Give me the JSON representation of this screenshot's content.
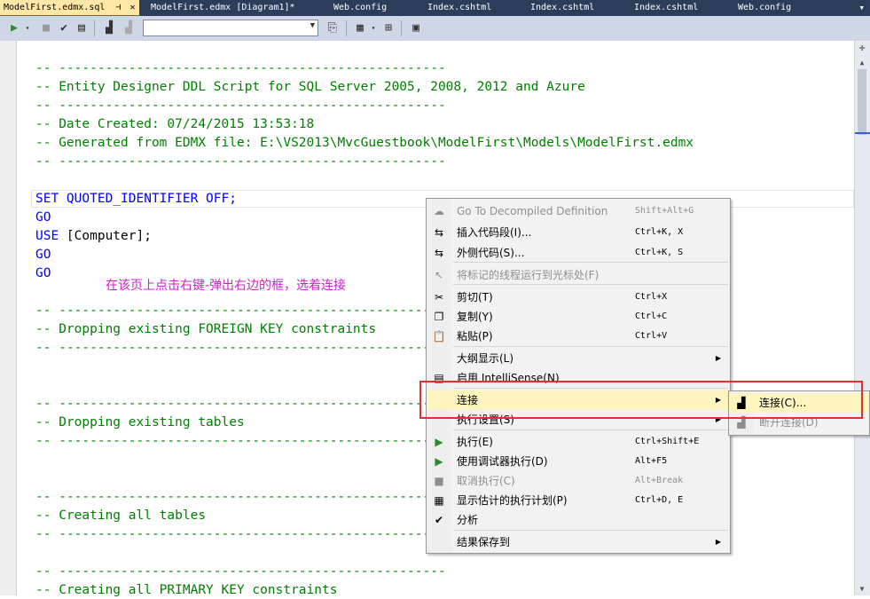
{
  "tabs": [
    {
      "label": "ModelFirst.edmx.sql",
      "active": true
    },
    {
      "label": "ModelFirst.edmx [Diagram1]*"
    },
    {
      "label": "Web.config"
    },
    {
      "label": "Index.cshtml"
    },
    {
      "label": "Index.cshtml"
    },
    {
      "label": "Index.cshtml"
    },
    {
      "label": "Web.config"
    }
  ],
  "tab_icons": {
    "pin": "pin-icon",
    "close": "close-icon",
    "overflow": "tab-overflow-icon"
  },
  "toolbar": {
    "database_select": {
      "value": ""
    }
  },
  "code_lines": [
    {
      "text": "-- --------------------------------------------------",
      "cls": "cmt"
    },
    {
      "text": "-- Entity Designer DDL Script for SQL Server 2005, 2008, 2012 and Azure",
      "cls": "cmt"
    },
    {
      "text": "-- --------------------------------------------------",
      "cls": "cmt"
    },
    {
      "text": "-- Date Created: 07/24/2015 13:53:18",
      "cls": "cmt"
    },
    {
      "text": "-- Generated from EDMX file: E:\\VS2013\\MvcGuestbook\\ModelFirst\\Models\\ModelFirst.edmx",
      "cls": "cmt"
    },
    {
      "text": "-- --------------------------------------------------",
      "cls": "cmt"
    },
    {
      "text": "",
      "cls": "txt"
    },
    {
      "text": "SET QUOTED_IDENTIFIER OFF;",
      "cls": "kw"
    },
    {
      "text": "GO",
      "cls": "kw"
    },
    {
      "text": "USE [Computer];",
      "cls": "mix"
    },
    {
      "text": "GO",
      "cls": "kw"
    },
    {
      "text": "GO",
      "cls": "kw"
    },
    {
      "text": "",
      "cls": "txt"
    },
    {
      "text": "-- --------------------------------------------------",
      "cls": "cmt"
    },
    {
      "text": "-- Dropping existing FOREIGN KEY constraints",
      "cls": "cmt"
    },
    {
      "text": "-- --------------------------------------------------",
      "cls": "cmt"
    },
    {
      "text": "",
      "cls": "txt"
    },
    {
      "text": "",
      "cls": "txt"
    },
    {
      "text": "-- --------------------------------------------------",
      "cls": "cmt"
    },
    {
      "text": "-- Dropping existing tables",
      "cls": "cmt"
    },
    {
      "text": "-- --------------------------------------------------",
      "cls": "cmt"
    },
    {
      "text": "",
      "cls": "txt"
    },
    {
      "text": "",
      "cls": "txt"
    },
    {
      "text": "-- --------------------------------------------------",
      "cls": "cmt"
    },
    {
      "text": "-- Creating all tables",
      "cls": "cmt"
    },
    {
      "text": "-- --------------------------------------------------",
      "cls": "cmt"
    },
    {
      "text": "",
      "cls": "txt"
    },
    {
      "text": "-- --------------------------------------------------",
      "cls": "cmt"
    },
    {
      "text": "-- Creating all PRIMARY KEY constraints",
      "cls": "cmt"
    }
  ],
  "use_line": {
    "keyword": "USE",
    "rest": " [Computer];"
  },
  "annotation": "在该页上点击右键-弹出右边的框，选着连接",
  "context_menu": {
    "items": [
      {
        "label": "Go To Decompiled Definition",
        "shortcut": "Shift+Alt+G",
        "icon": "decompile-icon",
        "glyph": "☁",
        "disabled": true
      },
      {
        "label": "插入代码段(I)...",
        "shortcut": "Ctrl+K, X",
        "icon": "snippet-icon",
        "glyph": "⇆"
      },
      {
        "label": "外侧代码(S)...",
        "shortcut": "Ctrl+K, S",
        "icon": "surround-icon",
        "glyph": "⇆"
      },
      {
        "label": "将标记的线程运行到光标处(F)",
        "shortcut": "",
        "icon": "run-to-cursor-icon",
        "glyph": "↖",
        "disabled": true
      },
      {
        "label": "剪切(T)",
        "shortcut": "Ctrl+X",
        "icon": "cut-icon",
        "glyph": "✂"
      },
      {
        "label": "复制(Y)",
        "shortcut": "Ctrl+C",
        "icon": "copy-icon",
        "glyph": "❐"
      },
      {
        "label": "粘贴(P)",
        "shortcut": "Ctrl+V",
        "icon": "paste-icon",
        "glyph": "📋"
      },
      {
        "label": "大纲显示(L)",
        "shortcut": "",
        "icon": "",
        "glyph": "",
        "submenu": true
      },
      {
        "label": "启用 IntelliSense(N)",
        "shortcut": "",
        "icon": "intellisense-icon",
        "glyph": "▤"
      },
      {
        "label": "连接",
        "shortcut": "",
        "icon": "",
        "glyph": "",
        "submenu": true,
        "highlighted": true
      },
      {
        "label": "执行设置(S)",
        "shortcut": "",
        "icon": "",
        "glyph": "",
        "submenu": true
      },
      {
        "label": "执行(E)",
        "shortcut": "Ctrl+Shift+E",
        "icon": "execute-icon",
        "glyph": "▶"
      },
      {
        "label": "使用调试器执行(D)",
        "shortcut": "Alt+F5",
        "icon": "debug-execute-icon",
        "glyph": "▶"
      },
      {
        "label": "取消执行(C)",
        "shortcut": "Alt+Break",
        "icon": "cancel-execute-icon",
        "glyph": "■",
        "disabled": true
      },
      {
        "label": "显示估计的执行计划(P)",
        "shortcut": "Ctrl+D, E",
        "icon": "execution-plan-icon",
        "glyph": "▦"
      },
      {
        "label": "分析",
        "shortcut": "",
        "icon": "check-icon",
        "glyph": "✔"
      },
      {
        "label": "结果保存到",
        "shortcut": "",
        "icon": "",
        "glyph": "",
        "submenu": true
      }
    ]
  },
  "connect_submenu": {
    "items": [
      {
        "label": "连接(C)...",
        "icon": "connect-icon",
        "glyph": "▟",
        "highlighted": true
      },
      {
        "label": "断开连接(D)",
        "icon": "disconnect-icon",
        "glyph": "▟",
        "disabled": true
      }
    ]
  }
}
